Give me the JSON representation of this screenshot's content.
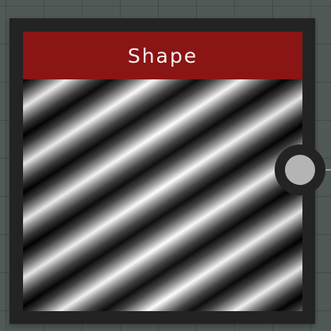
{
  "node": {
    "title": "Shape",
    "header_color": "#8b1414",
    "body_color": "#232323",
    "preview": {
      "type": "wave-stripes",
      "description_colors": [
        "#000000",
        "#ffffff"
      ]
    },
    "output_port": {
      "icon": "circle-port-icon",
      "color": "#b4b4b4"
    }
  },
  "canvas": {
    "background_color": "#505956"
  }
}
